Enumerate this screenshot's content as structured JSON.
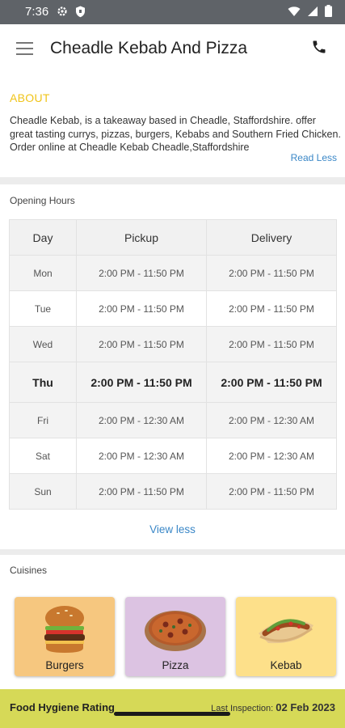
{
  "status_bar": {
    "time": "7:36"
  },
  "header": {
    "title": "Cheadle Kebab And Pizza"
  },
  "about": {
    "title": "ABOUT",
    "text": "Cheadle Kebab, is a takeaway based in Cheadle, Staffordshire. offer great tasting currys, pizzas, burgers, Kebabs and Southern Fried Chicken. Order online at Cheadle Kebab Cheadle,Staffordshire",
    "read_less": "Read Less"
  },
  "opening_hours": {
    "title": "Opening Hours",
    "columns": [
      "Day",
      "Pickup",
      "Delivery"
    ],
    "rows": [
      {
        "day": "Mon",
        "pickup": "2:00 PM - 11:50 PM",
        "delivery": "2:00 PM - 11:50 PM"
      },
      {
        "day": "Tue",
        "pickup": "2:00 PM - 11:50 PM",
        "delivery": "2:00 PM - 11:50 PM"
      },
      {
        "day": "Wed",
        "pickup": "2:00 PM - 11:50 PM",
        "delivery": "2:00 PM - 11:50 PM"
      },
      {
        "day": "Thu",
        "pickup": "2:00 PM - 11:50 PM",
        "delivery": "2:00 PM - 11:50 PM",
        "today": true
      },
      {
        "day": "Fri",
        "pickup": "2:00 PM - 12:30 AM",
        "delivery": "2:00 PM - 12:30 AM"
      },
      {
        "day": "Sat",
        "pickup": "2:00 PM - 12:30 AM",
        "delivery": "2:00 PM - 12:30 AM"
      },
      {
        "day": "Sun",
        "pickup": "2:00 PM - 11:50 PM",
        "delivery": "2:00 PM - 11:50 PM"
      }
    ],
    "view_less": "View less"
  },
  "cuisines": {
    "title": "Cuisines",
    "items": [
      {
        "label": "Burgers",
        "icon": "burger-icon",
        "bg": "#f6c77f"
      },
      {
        "label": "Pizza",
        "icon": "pizza-icon",
        "bg": "#dcc3e2"
      },
      {
        "label": "Kebab",
        "icon": "kebab-icon",
        "bg": "#fde08a"
      }
    ]
  },
  "food_hygiene": {
    "title": "Food Hygiene Rating",
    "last_inspection_label": "Last Inspection:",
    "last_inspection_date": "02 Feb 2023"
  },
  "colors": {
    "accent": "#f0c419",
    "link": "#3a87c7",
    "hygiene_bar": "#d6d957"
  }
}
